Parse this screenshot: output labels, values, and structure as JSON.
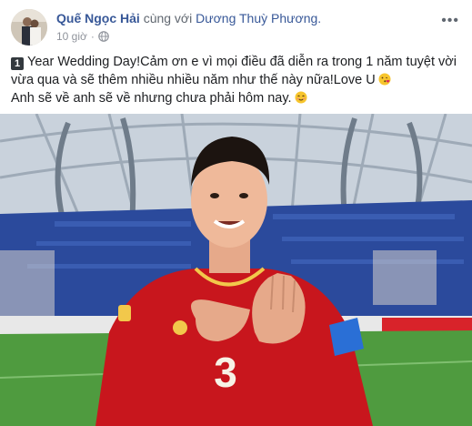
{
  "post": {
    "author": "Quế Ngọc Hải",
    "with_text": "cùng với",
    "tagged": "Dương Thuỳ Phương.",
    "time": "10 giờ",
    "menu_icon": "more-horizontal-icon",
    "privacy_icon": "globe-icon",
    "badge_number": "1",
    "line1": "Year Wedding Day!Cảm ơn e vì mọi điều đã diễn ra trong 1 năm tuyệt vời",
    "line2": "vừa qua và sẽ thêm nhiều nhiều năm như thế này nữa!Love U",
    "line3": "Anh sẽ về anh sẽ về nhưng chưa phải hôm nay.",
    "emoji1": "kiss-heart-emoji",
    "emoji2": "blushing-smile-emoji"
  },
  "photo": {
    "jersey_number": "3",
    "colors": {
      "jersey": "#c8161d",
      "armband": "#2a6fd6",
      "pitch": "#4f9b3f",
      "stands": "#2b4a9c",
      "roof": "#c9d2dc"
    }
  }
}
